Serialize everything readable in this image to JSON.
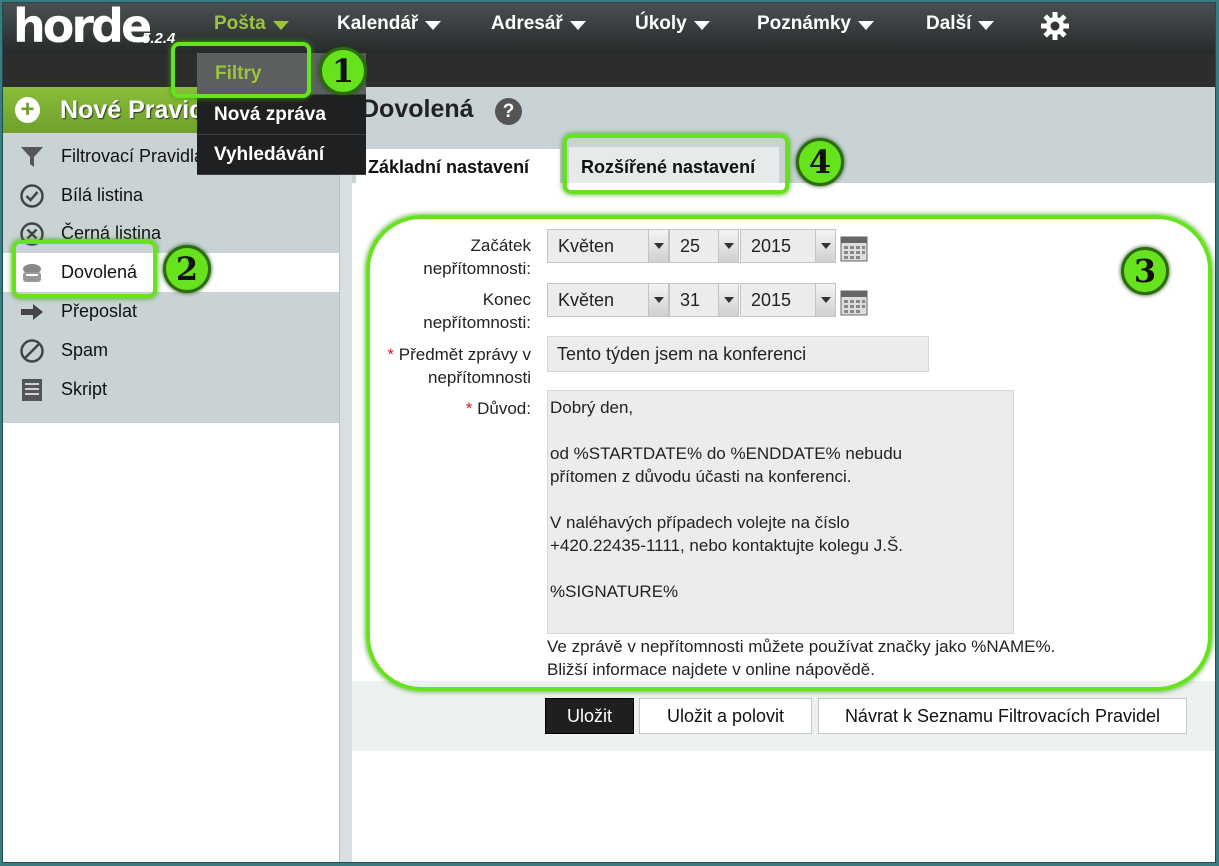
{
  "app": {
    "logo": "horde",
    "version": "5.2.4"
  },
  "nav": [
    {
      "label": "Pošta",
      "active": true
    },
    {
      "label": "Kalendář"
    },
    {
      "label": "Adresář"
    },
    {
      "label": "Úkoly"
    },
    {
      "label": "Poznámky"
    },
    {
      "label": "Další"
    }
  ],
  "dropdown": [
    "Filtry",
    "Nová zpráva",
    "Vyhledávání"
  ],
  "sidebar": {
    "new_rule": "Nové Pravidlo",
    "items": [
      {
        "label": "Filtrovací Pravidla",
        "icon": "funnel-icon"
      },
      {
        "label": "Bílá listina",
        "icon": "check-circle-icon"
      },
      {
        "label": "Černá listina",
        "icon": "x-circle-icon"
      },
      {
        "label": "Dovolená",
        "icon": "vacation-icon",
        "active": true
      },
      {
        "label": "Přeposlat",
        "icon": "arrow-right-icon"
      },
      {
        "label": "Spam",
        "icon": "no-entry-icon"
      },
      {
        "label": "Skript",
        "icon": "script-icon"
      }
    ]
  },
  "page": {
    "title": "Dovolená",
    "tabs": [
      "Základní nastavení",
      "Rozšířené nastavení"
    ]
  },
  "form": {
    "start_label_1": "Začátek",
    "start_label_2": "nepřítomnosti:",
    "end_label_1": "Konec",
    "end_label_2": "nepřítomnosti:",
    "subject_label_1": "Předmět zprávy v",
    "subject_label_2": "nepřítomnosti",
    "reason_label": "Důvod:",
    "required_mark": "*",
    "start": {
      "month": "Květen",
      "day": "25",
      "year": "2015"
    },
    "end": {
      "month": "Květen",
      "day": "31",
      "year": "2015"
    },
    "subject_value": "Tento týden jsem na konferenci",
    "reason_value": "Dobrý den,\n\nod %STARTDATE% do %ENDDATE% nebudu\npřítomen z důvodu účasti na konferenci.\n\nV naléhavých případech volejte na číslo\n+420.22435-1111, nebo kontaktujte kolegu J.Š.\n\n%SIGNATURE%",
    "hint_1": "Ve zprávě v nepřítomnosti můžete používat značky jako %NAME%.",
    "hint_2": "Bližší informace najdete v online nápovědě."
  },
  "buttons": {
    "save": "Uložit",
    "save_enable": "Uložit a polovit",
    "back": "Návrat k Seznamu Filtrovacích Pravidel"
  },
  "callouts": [
    "1",
    "2",
    "3",
    "4"
  ],
  "colors": {
    "highlight": "#66e31c",
    "accent_green": "#9bc53d",
    "topbar": "#2d2d2d"
  }
}
